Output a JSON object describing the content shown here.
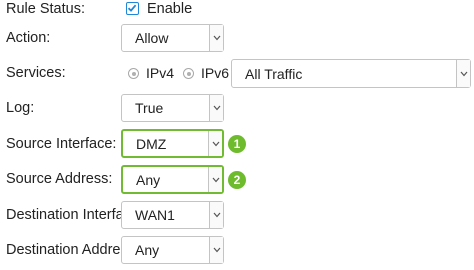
{
  "rule_status": {
    "label": "Rule Status:",
    "checkbox_checked": true,
    "checkbox_label": "Enable"
  },
  "action": {
    "label": "Action:",
    "value": "Allow"
  },
  "services": {
    "label": "Services:",
    "radio_options": [
      "IPv4",
      "IPv6"
    ],
    "value": "All Traffic"
  },
  "log": {
    "label": "Log:",
    "value": "True"
  },
  "source_interface": {
    "label": "Source Interface:",
    "value": "DMZ",
    "badge": "1"
  },
  "source_address": {
    "label": "Source Address:",
    "value": "Any",
    "badge": "2"
  },
  "destination_interface": {
    "label": "Destination Interface:",
    "value": "WAN1"
  },
  "destination_address": {
    "label": "Destination Address:",
    "value": "Any"
  },
  "colors": {
    "accent_green": "#6fbb2e",
    "checkbox_blue": "#1e87d8"
  },
  "icons": [
    "check-icon",
    "chevron-down-icon"
  ]
}
